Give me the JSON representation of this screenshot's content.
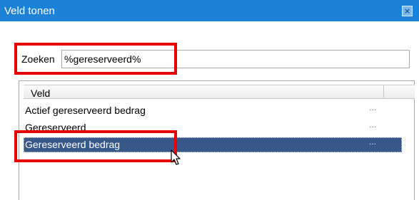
{
  "window": {
    "title": "Veld tonen",
    "close_glyph": "×"
  },
  "search": {
    "label": "Zoeken",
    "value": "%gereserveerd%"
  },
  "grid": {
    "column_header": "Veld",
    "rows": [
      {
        "label": "Actief gereserveerd bedrag",
        "more": "...",
        "selected": false
      },
      {
        "label": "Gereserveerd",
        "more": "...",
        "selected": false
      },
      {
        "label": "Gereserveerd bedrag",
        "more": "...",
        "selected": true
      }
    ]
  },
  "annotation_color": "#e60000",
  "selection_color": "#38588a",
  "titlebar_color": "#1b82d8",
  "icons": {
    "close": "close-icon",
    "cursor": "mouse-pointer-icon"
  }
}
